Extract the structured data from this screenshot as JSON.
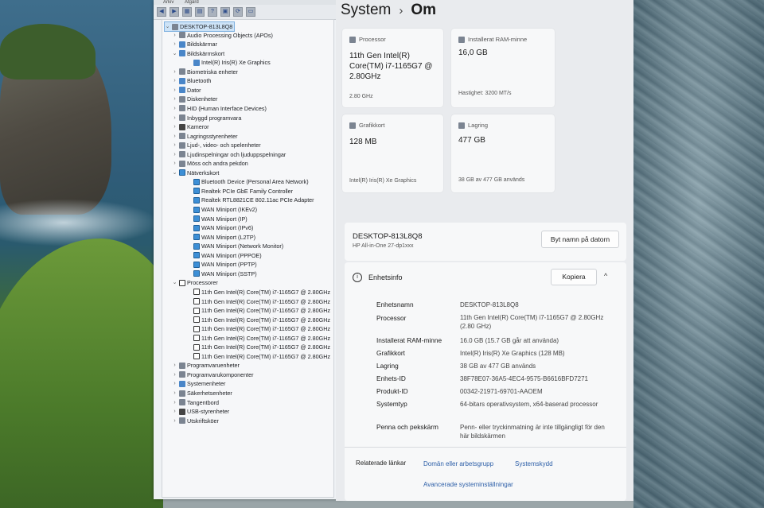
{
  "devmgr": {
    "menu": [
      "Arkiv",
      "Åtgärd"
    ],
    "tree": [
      {
        "label": "DESKTOP-813L8Q8",
        "level": 0,
        "chev": "⌄",
        "icon": "grey",
        "selected": true
      },
      {
        "label": "Audio Processing Objects (APOs)",
        "level": 1,
        "chev": "›",
        "icon": "grey"
      },
      {
        "label": "Bildskärmar",
        "level": 1,
        "chev": "›",
        "icon": "blue"
      },
      {
        "label": "Bildskärmskort",
        "level": 1,
        "chev": "⌄",
        "icon": "blue"
      },
      {
        "label": "Intel(R) Iris(R) Xe Graphics",
        "level": 2,
        "chev": "",
        "icon": "blue"
      },
      {
        "label": "Biometriska enheter",
        "level": 1,
        "chev": "›",
        "icon": "grey"
      },
      {
        "label": "Bluetooth",
        "level": 1,
        "chev": "›",
        "icon": "blue"
      },
      {
        "label": "Dator",
        "level": 1,
        "chev": "›",
        "icon": "blue"
      },
      {
        "label": "Diskenheter",
        "level": 1,
        "chev": "›",
        "icon": "grey"
      },
      {
        "label": "HID (Human Interface Devices)",
        "level": 1,
        "chev": "›",
        "icon": "grey"
      },
      {
        "label": "Inbyggd programvara",
        "level": 1,
        "chev": "›",
        "icon": "grey"
      },
      {
        "label": "Kameror",
        "level": 1,
        "chev": "›",
        "icon": "dark"
      },
      {
        "label": "Lagringsstyrenheter",
        "level": 1,
        "chev": "›",
        "icon": "grey"
      },
      {
        "label": "Ljud-, video- och spelenheter",
        "level": 1,
        "chev": "›",
        "icon": "grey"
      },
      {
        "label": "Ljudinspelningar och ljuduppspelningar",
        "level": 1,
        "chev": "›",
        "icon": "grey"
      },
      {
        "label": "Möss och andra pekdon",
        "level": 1,
        "chev": "›",
        "icon": "grey"
      },
      {
        "label": "Nätverkskort",
        "level": 1,
        "chev": "⌄",
        "icon": "net"
      },
      {
        "label": "Bluetooth Device (Personal Area Network)",
        "level": 2,
        "chev": "",
        "icon": "net"
      },
      {
        "label": "Realtek PCIe GbE Family Controller",
        "level": 2,
        "chev": "",
        "icon": "net"
      },
      {
        "label": "Realtek RTL8821CE 802.11ac PCIe Adapter",
        "level": 2,
        "chev": "",
        "icon": "net"
      },
      {
        "label": "WAN Miniport (IKEv2)",
        "level": 2,
        "chev": "",
        "icon": "net"
      },
      {
        "label": "WAN Miniport (IP)",
        "level": 2,
        "chev": "",
        "icon": "net"
      },
      {
        "label": "WAN Miniport (IPv6)",
        "level": 2,
        "chev": "",
        "icon": "net"
      },
      {
        "label": "WAN Miniport (L2TP)",
        "level": 2,
        "chev": "",
        "icon": "net"
      },
      {
        "label": "WAN Miniport (Network Monitor)",
        "level": 2,
        "chev": "",
        "icon": "net"
      },
      {
        "label": "WAN Miniport (PPPOE)",
        "level": 2,
        "chev": "",
        "icon": "net"
      },
      {
        "label": "WAN Miniport (PPTP)",
        "level": 2,
        "chev": "",
        "icon": "net"
      },
      {
        "label": "WAN Miniport (SSTP)",
        "level": 2,
        "chev": "",
        "icon": "net"
      },
      {
        "label": "Processorer",
        "level": 1,
        "chev": "⌄",
        "icon": "cpu"
      },
      {
        "label": "11th Gen Intel(R) Core(TM) i7-1165G7 @ 2.80GHz",
        "level": 2,
        "chev": "",
        "icon": "cpu"
      },
      {
        "label": "11th Gen Intel(R) Core(TM) i7-1165G7 @ 2.80GHz",
        "level": 2,
        "chev": "",
        "icon": "cpu"
      },
      {
        "label": "11th Gen Intel(R) Core(TM) i7-1165G7 @ 2.80GHz",
        "level": 2,
        "chev": "",
        "icon": "cpu"
      },
      {
        "label": "11th Gen Intel(R) Core(TM) i7-1165G7 @ 2.80GHz",
        "level": 2,
        "chev": "",
        "icon": "cpu"
      },
      {
        "label": "11th Gen Intel(R) Core(TM) i7-1165G7 @ 2.80GHz",
        "level": 2,
        "chev": "",
        "icon": "cpu"
      },
      {
        "label": "11th Gen Intel(R) Core(TM) i7-1165G7 @ 2.80GHz",
        "level": 2,
        "chev": "",
        "icon": "cpu"
      },
      {
        "label": "11th Gen Intel(R) Core(TM) i7-1165G7 @ 2.80GHz",
        "level": 2,
        "chev": "",
        "icon": "cpu"
      },
      {
        "label": "11th Gen Intel(R) Core(TM) i7-1165G7 @ 2.80GHz",
        "level": 2,
        "chev": "",
        "icon": "cpu"
      },
      {
        "label": "Programvaruenheter",
        "level": 1,
        "chev": "›",
        "icon": "grey"
      },
      {
        "label": "Programvarukomponenter",
        "level": 1,
        "chev": "›",
        "icon": "grey"
      },
      {
        "label": "Systemenheter",
        "level": 1,
        "chev": "›",
        "icon": "blue"
      },
      {
        "label": "Säkerhetsenheter",
        "level": 1,
        "chev": "›",
        "icon": "grey"
      },
      {
        "label": "Tangentbord",
        "level": 1,
        "chev": "›",
        "icon": "grey"
      },
      {
        "label": "USB-styrenheter",
        "level": 1,
        "chev": "›",
        "icon": "dark"
      },
      {
        "label": "Utskriftsköer",
        "level": 1,
        "chev": "›",
        "icon": "grey"
      }
    ]
  },
  "settings": {
    "breadcrumb_parent": "System",
    "breadcrumb_sep": "›",
    "breadcrumb_current": "Om",
    "cards": {
      "processor": {
        "label": "Processor",
        "value": "11th Gen Intel(R) Core(TM) i7-1165G7 @ 2.80GHz",
        "sub": "2.80 GHz"
      },
      "ram": {
        "label": "Installerat RAM-minne",
        "value": "16,0 GB",
        "sub": "Hastighet: 3200 MT/s"
      },
      "gpu": {
        "label": "Grafikkort",
        "value": "128 MB",
        "sub": "Intel(R) Iris(R) Xe Graphics"
      },
      "storage": {
        "label": "Lagring",
        "value": "477 GB",
        "sub": "38 GB av 477 GB används"
      }
    },
    "pc": {
      "name": "DESKTOP-813L8Q8",
      "model": "HP All-in-One 27-dp1xxx",
      "rename_label": "Byt namn på datorn"
    },
    "specs": {
      "title": "Enhetsinfo",
      "copy_label": "Kopiera",
      "collapse_glyph": "^",
      "rows": [
        {
          "k": "Enhetsnamn",
          "v": "DESKTOP-813L8Q8"
        },
        {
          "k": "Processor",
          "v": "11th Gen Intel(R) Core(TM) i7-1165G7 @ 2.80GHz (2.80 GHz)"
        },
        {
          "k": "Installerat RAM-minne",
          "v": "16.0 GB (15.7 GB går att använda)"
        },
        {
          "k": "Grafikkort",
          "v": "Intel(R) Iris(R) Xe Graphics (128 MB)"
        },
        {
          "k": "Lagring",
          "v": "38 GB av 477 GB används"
        },
        {
          "k": "Enhets-ID",
          "v": "38F78E07-36A5-4EC4-9575-B6616BFD7271"
        },
        {
          "k": "Produkt-ID",
          "v": "00342-21971-69701-AAOEM"
        },
        {
          "k": "Systemtyp",
          "v": "64-bitars operativsystem, x64-baserad processor"
        },
        {
          "k": "Penna och pekskärm",
          "v": "Penn- eller tryckinmatning är inte tillgängligt för den här bildskärmen"
        }
      ]
    },
    "related": {
      "label": "Relaterade länkar",
      "links": [
        "Domän eller arbetsgrupp",
        "Systemskydd",
        "Avancerade systeminställningar"
      ]
    }
  }
}
